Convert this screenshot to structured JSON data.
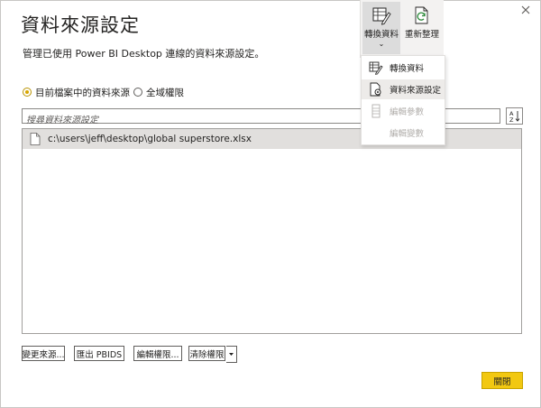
{
  "dialog": {
    "title": "資料來源設定",
    "subtitle": "管理已使用 Power BI Desktop 連線的資料來源設定。"
  },
  "scope": {
    "current_file_label": "目前檔案中的資料來源",
    "global_label": "全域權限",
    "selected": "current_file"
  },
  "search": {
    "placeholder": "搜尋資料來源設定",
    "value": ""
  },
  "sources": [
    {
      "path": "c:\\users\\jeff\\desktop\\global superstore.xlsx"
    }
  ],
  "actions": {
    "change_source": "變更來源...",
    "export_pbids": "匯出 PBIDS",
    "edit_permissions": "編輯權限...",
    "clear_permissions": "清除權限",
    "close": "關閉"
  },
  "ribbon": {
    "transform_data": "轉換資料",
    "refresh": "重新整理"
  },
  "transform_menu": {
    "items": [
      {
        "label": "轉換資料",
        "icon": "transform-data-icon",
        "enabled": true
      },
      {
        "label": "資料來源設定",
        "icon": "data-source-settings-icon",
        "enabled": true
      },
      {
        "label": "編輯參數",
        "icon": "edit-parameters-icon",
        "enabled": false
      },
      {
        "label": "編輯變數",
        "icon": "",
        "enabled": false
      }
    ]
  },
  "colors": {
    "accent_yellow": "#f2c811",
    "radio_selected": "#d7a600",
    "list_selected_bg": "#e1dfdd",
    "ribbon_bg": "#f3f2f1",
    "disabled_text": "#b3b0ad"
  }
}
